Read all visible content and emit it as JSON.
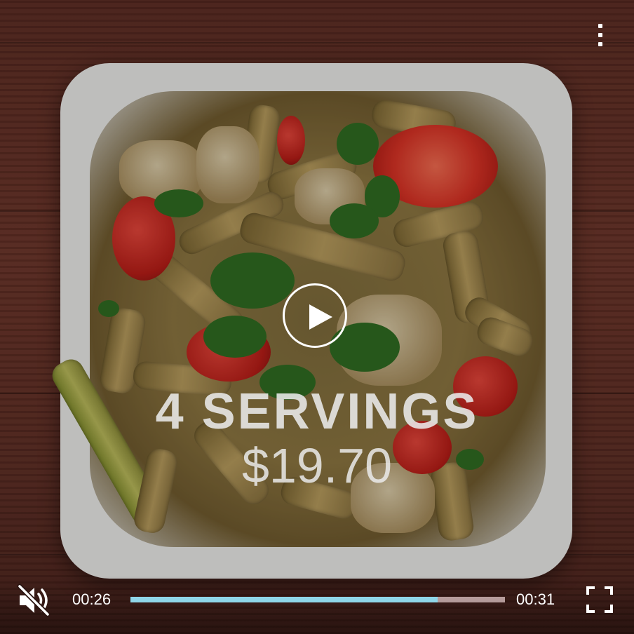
{
  "video": {
    "overlay_title": "4 SERVINGS",
    "overlay_price": "$19.70",
    "current_time": "00:26",
    "total_time": "00:31",
    "progress": 0.82
  },
  "icons": {
    "menu": "more-vertical-icon",
    "play": "play-icon",
    "mute": "volume-muted-icon",
    "fullscreen": "fullscreen-icon"
  },
  "colors": {
    "progress_fill": "#8fd6e8",
    "progress_track": "#e1c8c8",
    "icon": "#ffffff"
  }
}
